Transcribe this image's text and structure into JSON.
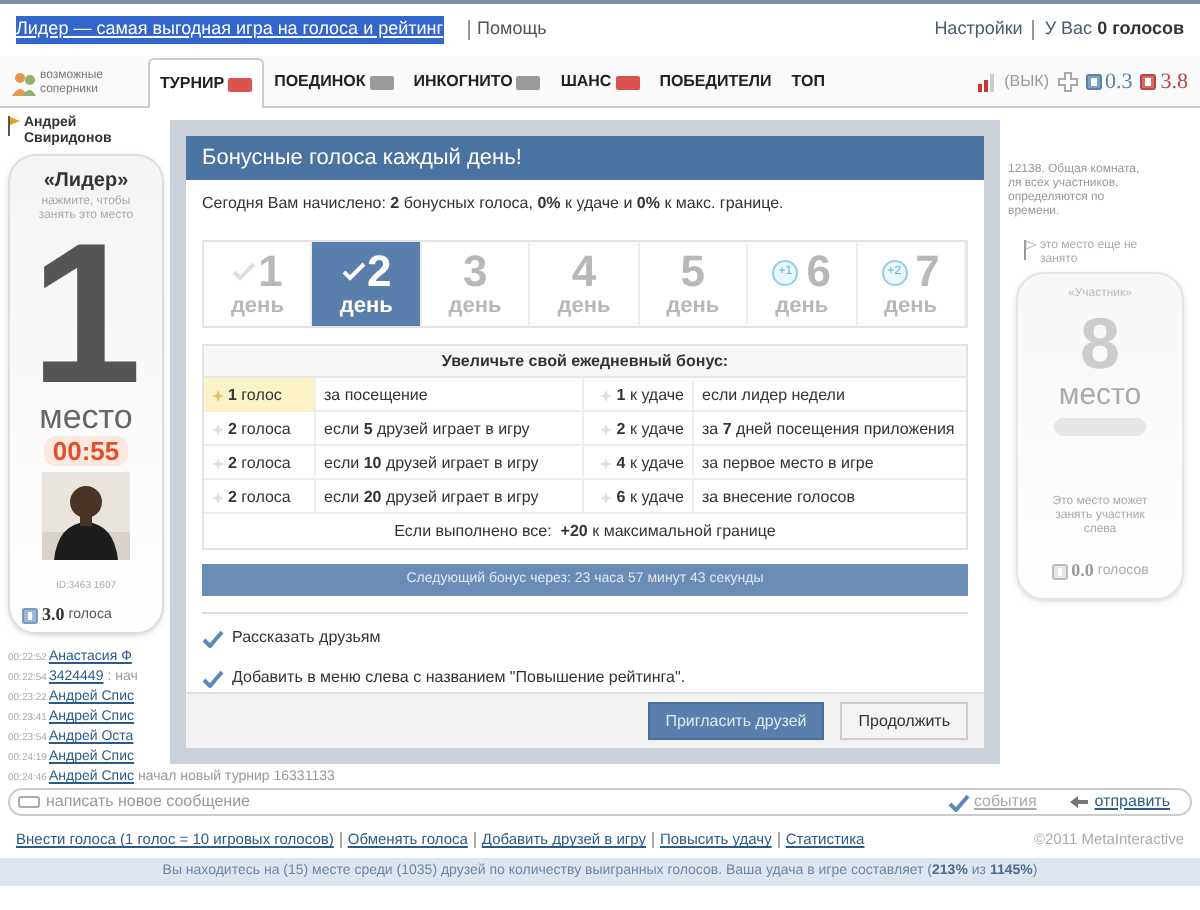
{
  "top_bar": {
    "title_link": "Лидер — самая выгодная игра на голоса и рейтинг",
    "help_link": "Помощь",
    "settings_link": "Настройки",
    "balance": "У Вас **0 голосов**"
  },
  "nav": {
    "logo_text": "возможные соперники",
    "tabs": [
      {
        "label": "ТУРНИР",
        "selected": true,
        "color": "#d9534f"
      },
      {
        "label": "ПОЕДИНОК",
        "selected": false,
        "color": "#9a9a9a"
      },
      {
        "label": "ИНКОГНИТО",
        "selected": false,
        "color": "#9a9a9a"
      },
      {
        "label": "ШАНС",
        "selected": false,
        "color": "#d9534f"
      },
      {
        "label": "ПОБЕДИТЕЛИ",
        "selected": false
      },
      {
        "label": "ТОП",
        "selected": false
      }
    ],
    "sound_toggle": "(ВЫК)",
    "blue_balance": "0.3",
    "red_balance": "3.8"
  },
  "left_card": {
    "owner": "Андрей Свиридонов",
    "role": "«Лидер»",
    "hint": "нажмите, чтобы занять это место",
    "number": "1",
    "place_label": "место",
    "timer": "00:55",
    "user_id": "ID:3463 1607",
    "votes": "3.0",
    "votes_label": "голоса"
  },
  "room_info": [
    "12138. Общая комната,",
    "ля всех участников.",
    "определяются по",
    "времени."
  ],
  "right_card": {
    "status": "это место еще не занято",
    "role": "«Участник»",
    "number": "8",
    "place_label": "место",
    "hint": "Это место может занять участник слева",
    "votes": "0.0",
    "votes_label": "голосов"
  },
  "chat": [
    {
      "time": "00:22:52",
      "author": "Анастасия Ф"
    },
    {
      "time": "00:22:54",
      "author": "3424449",
      "text": ": нач"
    },
    {
      "time": "00:23:22",
      "author": "Андрей Спис"
    },
    {
      "time": "00:23:41",
      "author": "Андрей Спис"
    },
    {
      "time": "00:23:54",
      "author": "Андрей Оста"
    },
    {
      "time": "00:24:19",
      "author": "Андрей Спис"
    },
    {
      "time": "00:24:46",
      "author": "Андрей Спис",
      "text": "начал новый турнир 16331133"
    }
  ],
  "message_bar": {
    "placeholder": "написать новое сообщение",
    "events": {
      "label": "события",
      "checked": true
    },
    "send": "отправить"
  },
  "footer_links": [
    "Внести голоса (1 голос = 10 игровых голосов)",
    "Обменять голоса",
    "Добавить друзей в игру",
    "Повысить удачу",
    "Статистика"
  ],
  "copyright": "©2011 MetaInteractive",
  "status_line": "Вы находитесь на (15) месте среди (1035) друзей по количеству выигранных голосов. Ваша удача в игре составляет (**213%** из **1145%**)",
  "modal": {
    "title": "Бонусные голоса каждый день!",
    "today": "Сегодня Вам начислено: **2** бонусных голоса, **0%** к удаче и **0%** к макс. границе.",
    "days": [
      {
        "number": "1",
        "label": "день",
        "checked": true,
        "selected": false
      },
      {
        "number": "2",
        "label": "день",
        "checked": true,
        "selected": true
      },
      {
        "number": "3",
        "label": "день",
        "checked": false,
        "selected": false
      },
      {
        "number": "4",
        "label": "день",
        "checked": false,
        "selected": false
      },
      {
        "number": "5",
        "label": "день",
        "checked": false,
        "selected": false
      },
      {
        "number": "6",
        "label": "день",
        "checked": false,
        "selected": false,
        "bonus": "+1"
      },
      {
        "number": "7",
        "label": "день",
        "checked": false,
        "selected": false,
        "bonus": "+2"
      }
    ],
    "table_title": "Увеличьте свой ежедневный бонус:",
    "rows": [
      {
        "left_amount": "**1** голос",
        "left_desc": "за посещение",
        "left_highlighted": true,
        "right_amount": "**1** к удаче",
        "right_desc": "если лидер недели"
      },
      {
        "left_amount": "**2** голоса",
        "left_desc": "если **5** друзей играет в игру",
        "left_highlighted": false,
        "right_amount": "**2** к удаче",
        "right_desc": "за **7** дней посещения приложения"
      },
      {
        "left_amount": "**2** голоса",
        "left_desc": "если **10** друзей играет в игру",
        "left_highlighted": false,
        "right_amount": "**4** к удаче",
        "right_desc": "за первое место в игре"
      },
      {
        "left_amount": "**2** голоса",
        "left_desc": "если **20** друзей играет в игру",
        "left_highlighted": false,
        "right_amount": "**6** к удаче",
        "right_desc": "за внесение голосов"
      }
    ],
    "total": "Если выполнено все:  **+20** к максимальной границе",
    "next_bonus": "Следующий бонус через: 23 часа 57 минут 43 секунды",
    "options": [
      {
        "label": "Рассказать друзьям",
        "checked": true
      },
      {
        "label": "Добавить в меню слева с названием \"Повышение рейтинга\".",
        "checked": true
      }
    ],
    "buttons": [
      {
        "label": "Пригласить друзей",
        "kind": "primary"
      },
      {
        "label": "Продолжить",
        "kind": "secondary"
      }
    ]
  }
}
